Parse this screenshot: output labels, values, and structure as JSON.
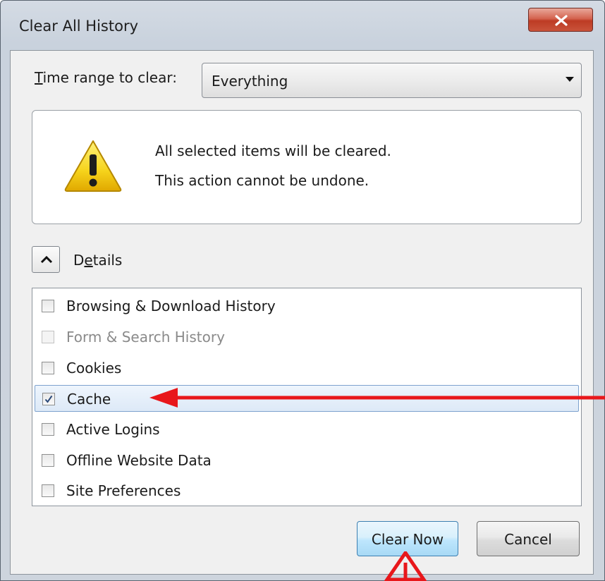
{
  "window": {
    "title": "Clear All History"
  },
  "time_range": {
    "label_prefix": "",
    "label_mnemonic": "T",
    "label_rest": "ime range to clear:",
    "selected": "Everything"
  },
  "warning": {
    "line1": "All selected items will be cleared.",
    "line2": "This action cannot be undone.",
    "icon": "warning-triangle-icon"
  },
  "details": {
    "label_prefix": "D",
    "label_mnemonic": "e",
    "label_rest": "tails",
    "expanded": true
  },
  "items": [
    {
      "label": "Browsing & Download History",
      "checked": false,
      "disabled": false
    },
    {
      "label": "Form & Search History",
      "checked": false,
      "disabled": true
    },
    {
      "label": "Cookies",
      "checked": false,
      "disabled": false
    },
    {
      "label": "Cache",
      "checked": true,
      "disabled": false
    },
    {
      "label": "Active Logins",
      "checked": false,
      "disabled": false
    },
    {
      "label": "Offline Website Data",
      "checked": false,
      "disabled": false
    },
    {
      "label": "Site Preferences",
      "checked": false,
      "disabled": false
    }
  ],
  "buttons": {
    "clear_now": "Clear Now",
    "cancel": "Cancel"
  },
  "colors": {
    "annotation_arrow": "#e8171b",
    "selected_row_border": "#7da2ce",
    "close_button": "#c9533a"
  }
}
